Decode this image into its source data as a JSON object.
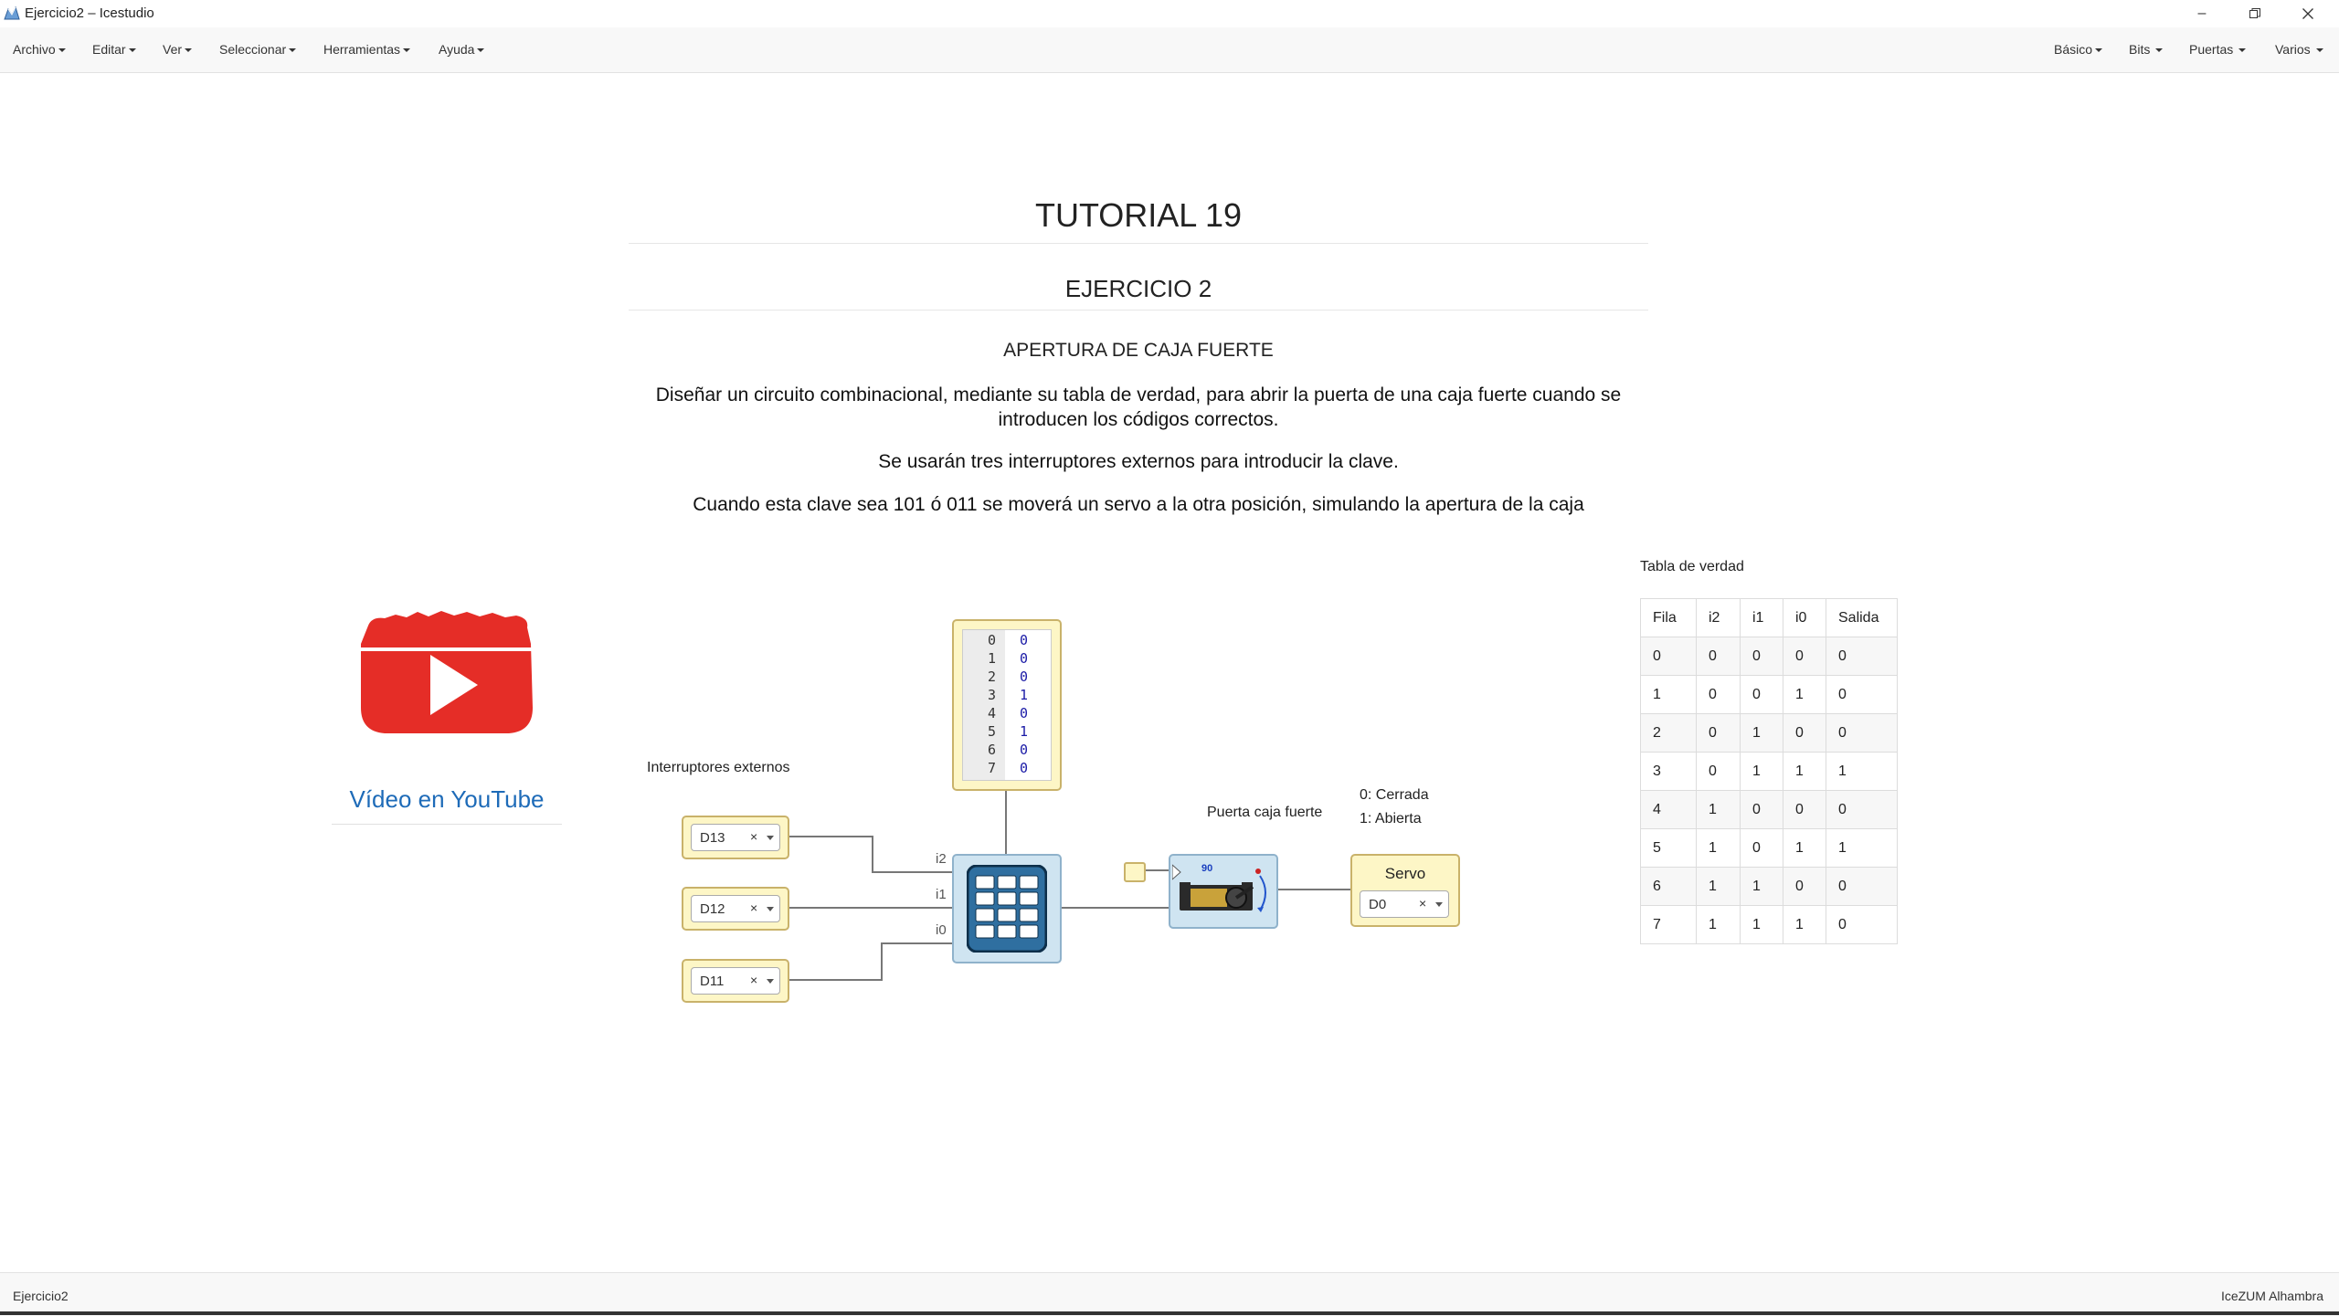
{
  "window": {
    "title": "Ejercicio2 – Icestudio"
  },
  "menu": {
    "left": [
      "Archivo",
      "Editar",
      "Ver",
      "Seleccionar",
      "Herramientas",
      "Ayuda"
    ],
    "right": [
      "Básico",
      "Bits",
      "Puertas",
      "Varios"
    ]
  },
  "doc": {
    "title": "TUTORIAL 19",
    "subtitle": "EJERCICIO 2",
    "section": "APERTURA DE CAJA FUERTE",
    "para1_line1": "Diseñar un circuito combinacional, mediante su tabla de verdad, para abrir la puerta de una caja fuerte cuando se",
    "para1_line2": "introducen los códigos correctos.",
    "para2": "Se usarán tres interruptores externos para introducir la clave.",
    "para3": "Cuando esta clave sea 101 ó 011 se moverá un servo a la otra posición, simulando la apertura de la caja"
  },
  "youtube": {
    "link_text": "Vídeo en YouTube",
    "brand_color": "#e52d27"
  },
  "circuit": {
    "inputs_label": "Interruptores externos",
    "inputs": [
      {
        "pin": "D13",
        "port": "i2"
      },
      {
        "pin": "D12",
        "port": "i1"
      },
      {
        "pin": "D11",
        "port": "i0"
      }
    ],
    "memory_index": [
      "0",
      "1",
      "2",
      "3",
      "4",
      "5",
      "6",
      "7"
    ],
    "memory_values": [
      "0",
      "0",
      "0",
      "1",
      "0",
      "1",
      "0",
      "0"
    ],
    "output_label": "Puerta caja fuerte",
    "output_states": [
      "0: Cerrada",
      "1: Abierta"
    ],
    "servo_text": "90",
    "servo_label": "Servo",
    "servo_pin": "D0",
    "clear_symbol": "×"
  },
  "truth_table": {
    "title": "Tabla de verdad",
    "headers": [
      "Fila",
      "i2",
      "i1",
      "i0",
      "Salida"
    ],
    "rows": [
      [
        "0",
        "0",
        "0",
        "0",
        "0"
      ],
      [
        "1",
        "0",
        "0",
        "1",
        "0"
      ],
      [
        "2",
        "0",
        "1",
        "0",
        "0"
      ],
      [
        "3",
        "0",
        "1",
        "1",
        "1"
      ],
      [
        "4",
        "1",
        "0",
        "0",
        "0"
      ],
      [
        "5",
        "1",
        "0",
        "1",
        "1"
      ],
      [
        "6",
        "1",
        "1",
        "0",
        "0"
      ],
      [
        "7",
        "1",
        "1",
        "1",
        "0"
      ]
    ]
  },
  "status": {
    "left": "Ejercicio2",
    "right": "IceZUM Alhambra"
  }
}
